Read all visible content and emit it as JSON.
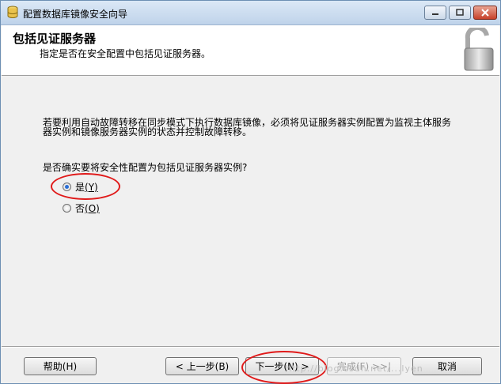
{
  "window": {
    "title": "配置数据库镜像安全向导"
  },
  "header": {
    "title": "包括见证服务器",
    "subtitle": "指定是否在安全配置中包括见证服务器。"
  },
  "body": {
    "description_line1": "若要利用自动故障转移在同步模式下执行数据库镜像，必须将见证服务器实例配置为监视主体服务",
    "description_line2": "器实例和镜像服务器实例的状态并控制故障转移。",
    "question": "是否确实要将安全性配置为包括见证服务器实例?",
    "options": [
      {
        "label": "是",
        "mnemonic": "(Y)",
        "selected": true
      },
      {
        "label": "否",
        "mnemonic": "(O)",
        "selected": false
      }
    ]
  },
  "buttons": {
    "help": "帮助(H)",
    "back": "< 上一步(B)",
    "next": "下一步(N) >",
    "finish": "完成(F) >>|",
    "cancel": "取消"
  },
  "watermark": "http://blog.csdn.net/...lyen",
  "colors": {
    "annotation": "#e01a1a",
    "radio_selected": "#2a6fd6"
  }
}
